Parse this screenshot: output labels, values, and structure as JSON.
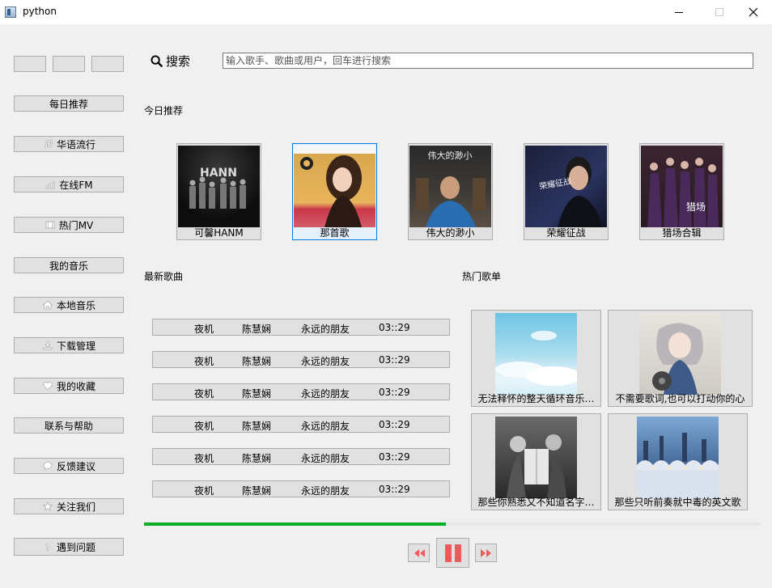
{
  "window": {
    "title": "python"
  },
  "search": {
    "label": "搜索",
    "placeholder": "输入歌手、歌曲或用户，回车进行搜索"
  },
  "sidebar": {
    "top_buttons": [
      "",
      "",
      ""
    ],
    "items": [
      {
        "label": "每日推荐",
        "icon": ""
      },
      {
        "label": "华语流行",
        "icon": "music-note-icon"
      },
      {
        "label": "在线FM",
        "icon": "signal-bars-icon"
      },
      {
        "label": "热门MV",
        "icon": "film-icon"
      },
      {
        "label": "我的音乐",
        "icon": ""
      },
      {
        "label": "本地音乐",
        "icon": "home-icon"
      },
      {
        "label": "下载管理",
        "icon": "download-icon"
      },
      {
        "label": "我的收藏",
        "icon": "heart-icon"
      },
      {
        "label": "联系与帮助",
        "icon": ""
      },
      {
        "label": "反馈建议",
        "icon": "comment-icon"
      },
      {
        "label": "关注我们",
        "icon": "star-icon"
      },
      {
        "label": "遇到问题",
        "icon": "question-icon"
      }
    ]
  },
  "daily": {
    "title": "今日推荐",
    "albums": [
      {
        "title": "可馨HANM",
        "cover_text": "HANN"
      },
      {
        "title": "那首歌",
        "cover_text": ""
      },
      {
        "title": "伟大的渺小",
        "cover_text": "伟大的渺小"
      },
      {
        "title": "荣耀征战",
        "cover_text": "荣耀征战"
      },
      {
        "title": "猎场合辑",
        "cover_text": "猎场"
      }
    ]
  },
  "latest": {
    "title": "最新歌曲",
    "songs": [
      {
        "name": "夜机",
        "artist": "陈慧娴",
        "album": "永远的朋友",
        "duration": "03::29"
      },
      {
        "name": "夜机",
        "artist": "陈慧娴",
        "album": "永远的朋友",
        "duration": "03::29"
      },
      {
        "name": "夜机",
        "artist": "陈慧娴",
        "album": "永远的朋友",
        "duration": "03::29"
      },
      {
        "name": "夜机",
        "artist": "陈慧娴",
        "album": "永远的朋友",
        "duration": "03::29"
      },
      {
        "name": "夜机",
        "artist": "陈慧娴",
        "album": "永远的朋友",
        "duration": "03::29"
      },
      {
        "name": "夜机",
        "artist": "陈慧娴",
        "album": "永远的朋友",
        "duration": "03::29"
      }
    ]
  },
  "hot": {
    "title": "热门歌单",
    "playlists": [
      {
        "title": "无法释怀的整天循环音乐…"
      },
      {
        "title": "不需要歌词,也可以打动你的心"
      },
      {
        "title": "那些你熟悉又不知道名字…"
      },
      {
        "title": "那些只听前奏就中毒的英文歌"
      }
    ]
  },
  "player": {
    "progress": 0.49
  },
  "colors": {
    "accent": "#0078d7",
    "progress": "#06b025",
    "playbutton": "#f05a5a"
  }
}
